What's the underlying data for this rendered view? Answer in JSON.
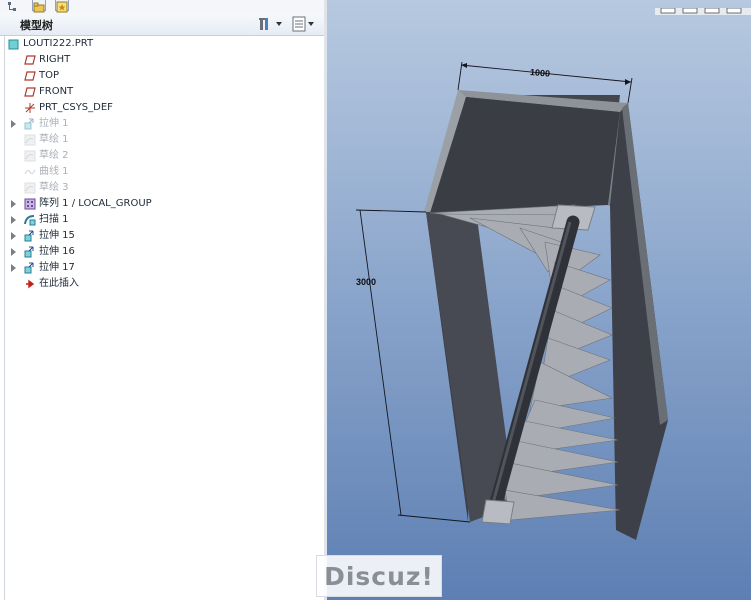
{
  "panel": {
    "title": "模型树"
  },
  "tree": {
    "root": "LOUTI222.PRT",
    "items": [
      {
        "label": "RIGHT",
        "icon": "datum-plane-icon",
        "expandable": false,
        "dim": false
      },
      {
        "label": "TOP",
        "icon": "datum-plane-icon",
        "expandable": false,
        "dim": false
      },
      {
        "label": "FRONT",
        "icon": "datum-plane-icon",
        "expandable": false,
        "dim": false
      },
      {
        "label": "PRT_CSYS_DEF",
        "icon": "coordinate-system-icon",
        "expandable": false,
        "dim": false
      },
      {
        "label": "拉伸 1",
        "icon": "extrude-icon",
        "expandable": true,
        "dim": true
      },
      {
        "label": "草绘 1",
        "icon": "sketch-icon",
        "expandable": false,
        "dim": true
      },
      {
        "label": "草绘 2",
        "icon": "sketch-icon",
        "expandable": false,
        "dim": true
      },
      {
        "label": "曲线 1",
        "icon": "curve-icon",
        "expandable": false,
        "dim": true
      },
      {
        "label": "草绘 3",
        "icon": "sketch-icon",
        "expandable": false,
        "dim": true
      },
      {
        "label": "阵列 1 / LOCAL_GROUP",
        "icon": "pattern-icon",
        "expandable": true,
        "dim": false
      },
      {
        "label": "扫描 1",
        "icon": "sweep-icon",
        "expandable": true,
        "dim": false
      },
      {
        "label": "拉伸 15",
        "icon": "extrude-icon",
        "expandable": true,
        "dim": false
      },
      {
        "label": "拉伸 16",
        "icon": "extrude-icon",
        "expandable": true,
        "dim": false
      },
      {
        "label": "拉伸 17",
        "icon": "extrude-icon",
        "expandable": true,
        "dim": false
      },
      {
        "label": "在此插入",
        "icon": "insert-here-arrow-icon",
        "expandable": false,
        "dim": false
      }
    ]
  },
  "viewport": {
    "dimension_width": "1000",
    "dimension_height": "3000"
  },
  "watermark": "Discuz!"
}
